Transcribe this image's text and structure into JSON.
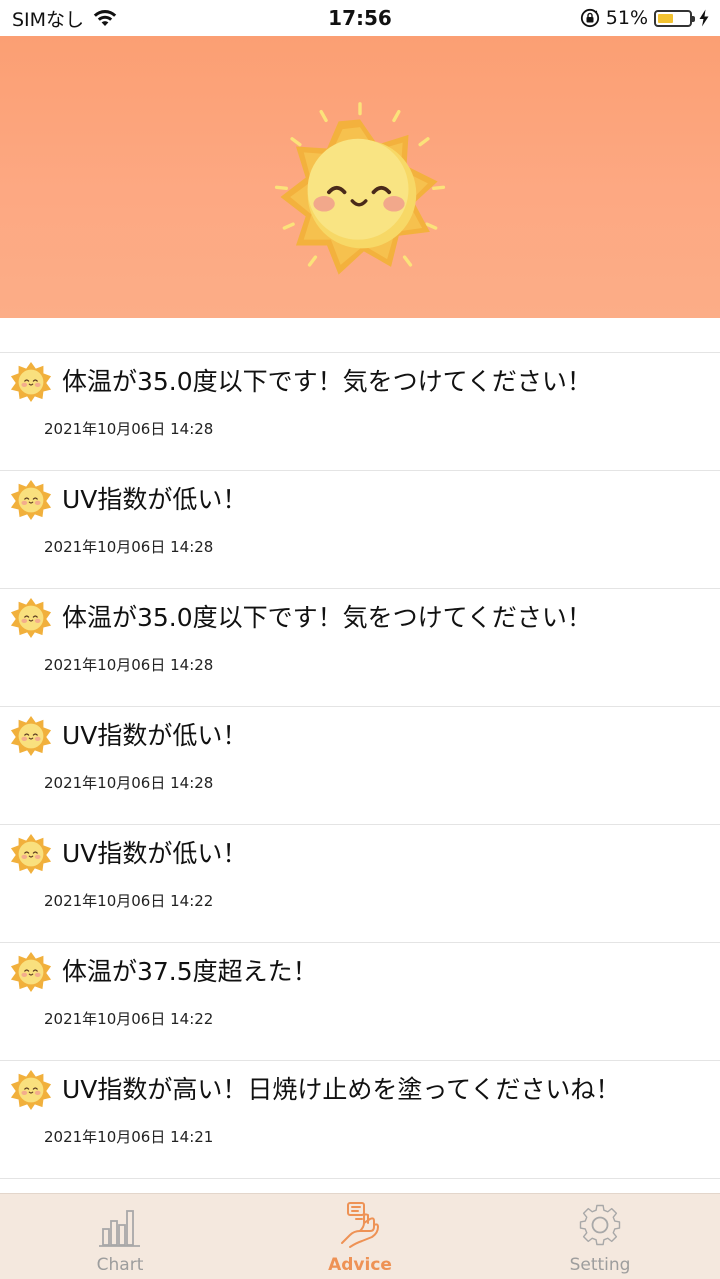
{
  "status_bar": {
    "carrier": "SIMなし",
    "time": "17:56",
    "battery_percent_label": "51%",
    "battery_level": 0.51,
    "icons": [
      "wifi-icon",
      "orientation-lock-icon",
      "battery-icon",
      "charging-bolt-icon"
    ]
  },
  "hero": {
    "illustration": "smiling-sun-icon",
    "colors": {
      "background": "#fca07a",
      "sun": "#f9e483",
      "sun_rays": "#f2b441"
    }
  },
  "advice": {
    "item_icon": "sun-face-icon",
    "items": [
      {
        "message": "体温が35.0度以下です！気をつけてください！",
        "time": "2021年10月06日 14:28"
      },
      {
        "message": "UV指数が低い！",
        "time": "2021年10月06日 14:28"
      },
      {
        "message": "体温が35.0度以下です！気をつけてください！",
        "time": "2021年10月06日 14:28"
      },
      {
        "message": "UV指数が低い！",
        "time": "2021年10月06日 14:28"
      },
      {
        "message": "UV指数が低い！",
        "time": "2021年10月06日 14:22"
      },
      {
        "message": "体温が37.5度超えた！",
        "time": "2021年10月06日 14:22"
      },
      {
        "message": "UV指数が高い！日焼け止めを塗ってくださいね！",
        "time": "2021年10月06日 14:21"
      }
    ]
  },
  "tab_bar": {
    "active": "advice",
    "tabs": [
      {
        "id": "chart",
        "label": "Chart",
        "icon": "bar-chart-icon"
      },
      {
        "id": "advice",
        "label": "Advice",
        "icon": "advice-hand-icon"
      },
      {
        "id": "setting",
        "label": "Setting",
        "icon": "gear-icon"
      }
    ],
    "colors": {
      "active": "#ee9255",
      "inactive": "#9d9d9d",
      "background": "#f4e8de"
    }
  }
}
